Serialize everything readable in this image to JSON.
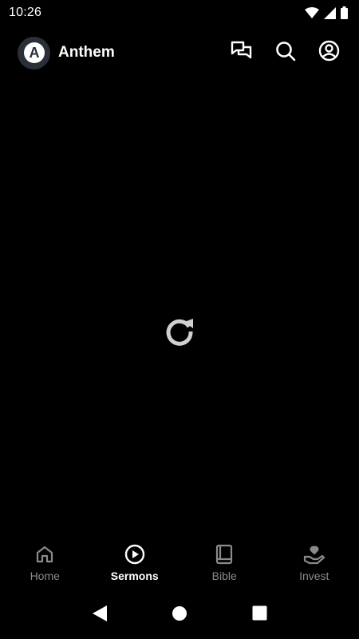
{
  "status_bar": {
    "time": "10:26",
    "icons": [
      "wifi-icon",
      "signal-icon",
      "battery-icon"
    ]
  },
  "app_bar": {
    "title": "Anthem",
    "logo_letter": "A",
    "actions": [
      "chat-icon",
      "search-icon",
      "account-icon"
    ]
  },
  "main": {
    "state": "loading",
    "icon": "refresh-icon"
  },
  "bottom_nav": {
    "items": [
      {
        "label": "Home",
        "icon": "home-icon",
        "active": false
      },
      {
        "label": "Sermons",
        "icon": "play-circle-icon",
        "active": true
      },
      {
        "label": "Bible",
        "icon": "book-icon",
        "active": false
      },
      {
        "label": "Invest",
        "icon": "hand-heart-icon",
        "active": false
      }
    ]
  },
  "system_nav": [
    "back-icon",
    "home-button-icon",
    "recents-icon"
  ],
  "colors": {
    "background": "#000000",
    "active": "#ffffff",
    "inactive": "#8a8a8a",
    "logo_bg": "#2a3038"
  }
}
